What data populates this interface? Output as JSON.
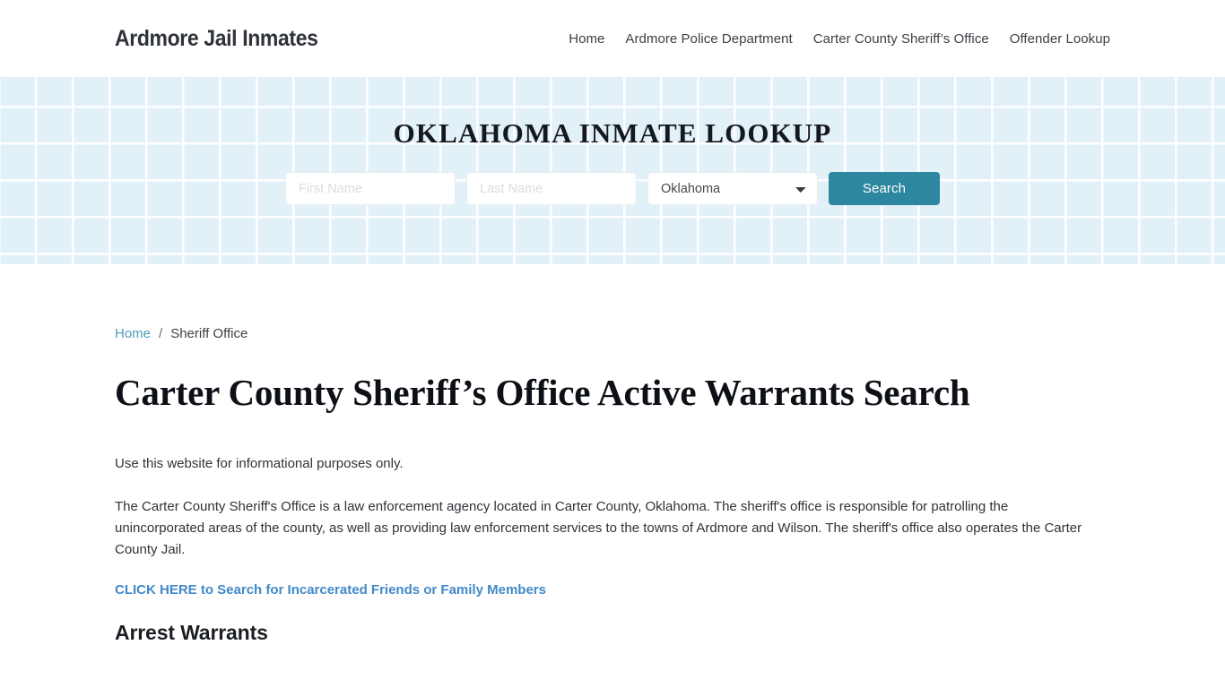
{
  "header": {
    "brand": "Ardmore Jail Inmates",
    "nav": [
      {
        "label": "Home"
      },
      {
        "label": "Ardmore Police Department"
      },
      {
        "label": "Carter County Sheriff’s Office"
      },
      {
        "label": "Offender Lookup"
      }
    ]
  },
  "hero": {
    "title": "OKLAHOMA INMATE LOOKUP",
    "background_color": "#e2f1f7",
    "form": {
      "first_name": {
        "value": "",
        "placeholder": "First Name"
      },
      "last_name": {
        "value": "",
        "placeholder": "Last Name"
      },
      "state": {
        "selected": "Oklahoma",
        "options": [
          "Oklahoma"
        ]
      },
      "submit_label": "Search",
      "submit_color": "#2e87a0"
    }
  },
  "breadcrumb": {
    "home_label": "Home",
    "separator": "/",
    "current_label": "Sheriff Office",
    "link_color": "#4e9cb5"
  },
  "main": {
    "page_title": "Carter County Sheriff’s Office Active Warrants Search",
    "paragraphs": [
      "Use this website for informational purposes only.",
      "The Carter County Sheriff's Office is a law enforcement agency located in Carter County, Oklahoma. The sheriff's office is responsible for patrolling the unincorporated areas of the county, as well as providing law enforcement services to the towns of Ardmore and Wilson. The sheriff's office also operates the Carter County Jail."
    ],
    "cta_link": {
      "label": "CLICK HERE to Search for Incarcerated Friends or Family Members",
      "color": "#4189c7"
    },
    "section_heading": "Arrest Warrants"
  }
}
